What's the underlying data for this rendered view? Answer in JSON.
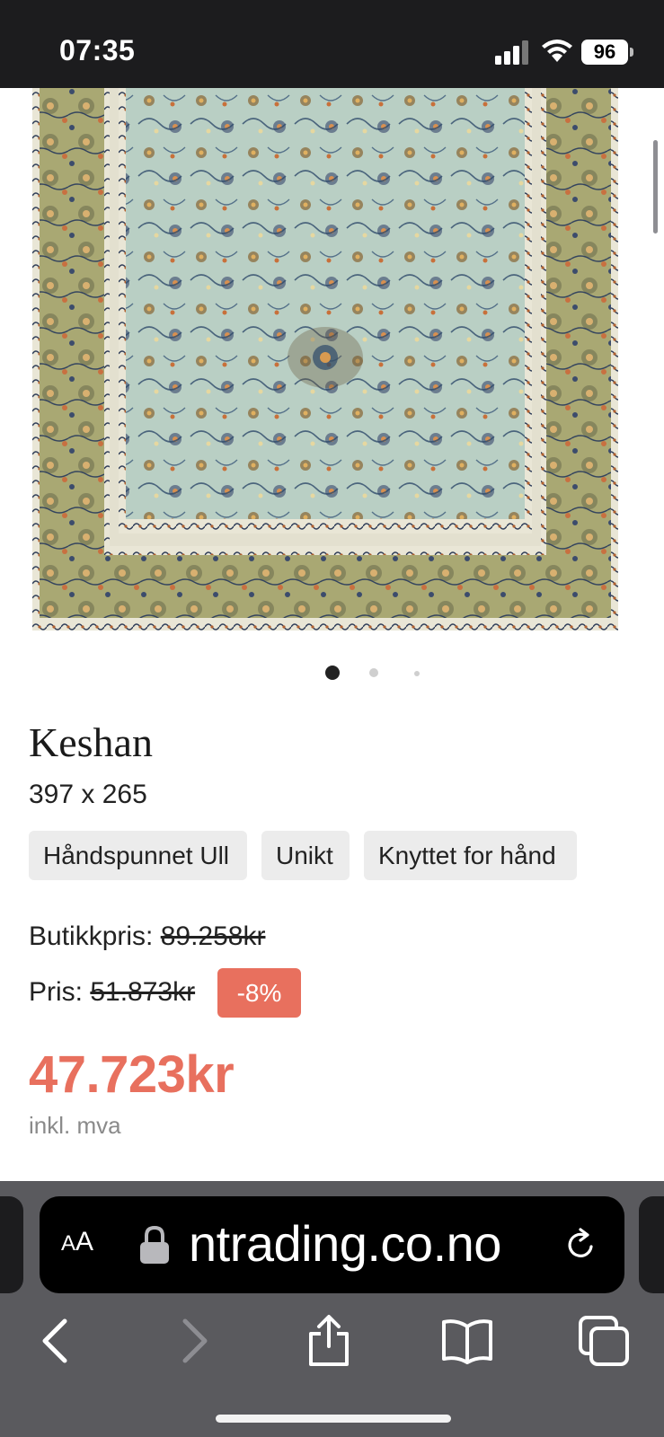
{
  "status_bar": {
    "time": "07:35",
    "battery": "96"
  },
  "product": {
    "title": "Keshan",
    "dimensions": "397 x 265",
    "tags": [
      "Håndspunnet Ull",
      "Unikt",
      "Knyttet for hånd"
    ],
    "store_price_label": "Butikkpris:",
    "store_price_value": "89.258kr",
    "price_label": "Pris:",
    "price_value": "51.873kr",
    "discount": "-8%",
    "final_price": "47.723kr",
    "vat_note": "inkl. mva"
  },
  "carousel": {
    "image_count": 3,
    "active_index": 0
  },
  "browser": {
    "aa_label": "A",
    "aa_label_big": "A",
    "url_text": "ntrading.co.no"
  },
  "colors": {
    "accent": "#e8705e",
    "rug_field": "#b9cfc4",
    "rug_border": "#a9a873"
  },
  "icons": [
    "signal-icon",
    "wifi-icon",
    "lock-icon",
    "reload-icon",
    "back-icon",
    "forward-icon",
    "share-icon",
    "bookmarks-icon",
    "tabs-icon"
  ]
}
